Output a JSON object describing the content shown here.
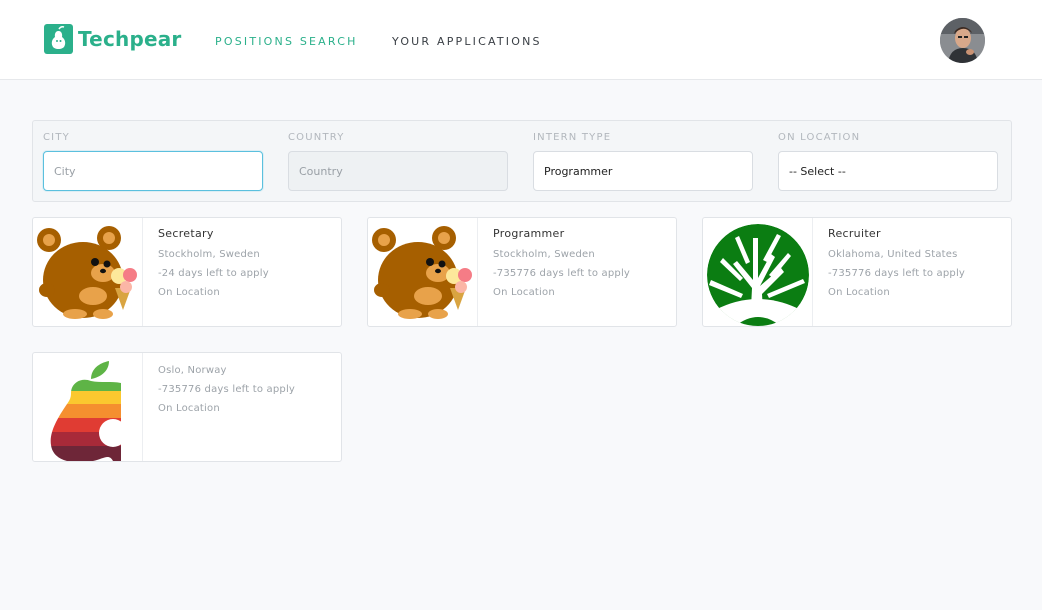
{
  "brand": {
    "name": "Techpear",
    "accent": "#2bb08b"
  },
  "nav": {
    "positions_search": "Positions Search",
    "your_applications": "Your Applications"
  },
  "user": {
    "avatar": "user-avatar-icon"
  },
  "filters": {
    "city": {
      "label": "City",
      "placeholder": "City",
      "value": ""
    },
    "country": {
      "label": "Country",
      "placeholder": "Country",
      "value": ""
    },
    "intern_type": {
      "label": "Intern Type",
      "value": "Programmer"
    },
    "on_location": {
      "label": "On Location",
      "selected": "-- Select --"
    }
  },
  "cards": [
    {
      "title": "Secretary",
      "location": "Stockholm, Sweden",
      "days_left": "-24 days left to apply",
      "mode": "On Location",
      "image": "bear-icon"
    },
    {
      "title": "Programmer",
      "location": "Stockholm, Sweden",
      "days_left": "-735776 days left to apply",
      "mode": "On Location",
      "image": "bear-icon"
    },
    {
      "title": "Recruiter",
      "location": "Oklahoma, United States",
      "days_left": "-735776 days left to apply",
      "mode": "On Location",
      "image": "tree-icon"
    },
    {
      "title": "",
      "location": "Oslo, Norway",
      "days_left": "-735776 days left to apply",
      "mode": "On Location",
      "image": "rainbow-pear-icon"
    }
  ]
}
